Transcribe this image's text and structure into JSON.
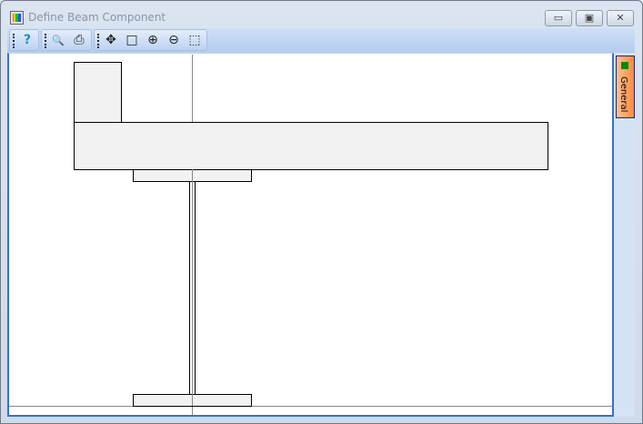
{
  "window": {
    "title": "Define Beam Component",
    "minimize": "▭",
    "maximize": "▣",
    "close": "✕"
  },
  "toolbar": {
    "help": "?",
    "preview": "🔍",
    "print": "⎙",
    "pan": "✥",
    "select": "□",
    "zoom_in": "⊕",
    "zoom_out": "⊖",
    "zoom_window": "⬚"
  },
  "side_tabs": [
    {
      "label": "General"
    }
  ]
}
